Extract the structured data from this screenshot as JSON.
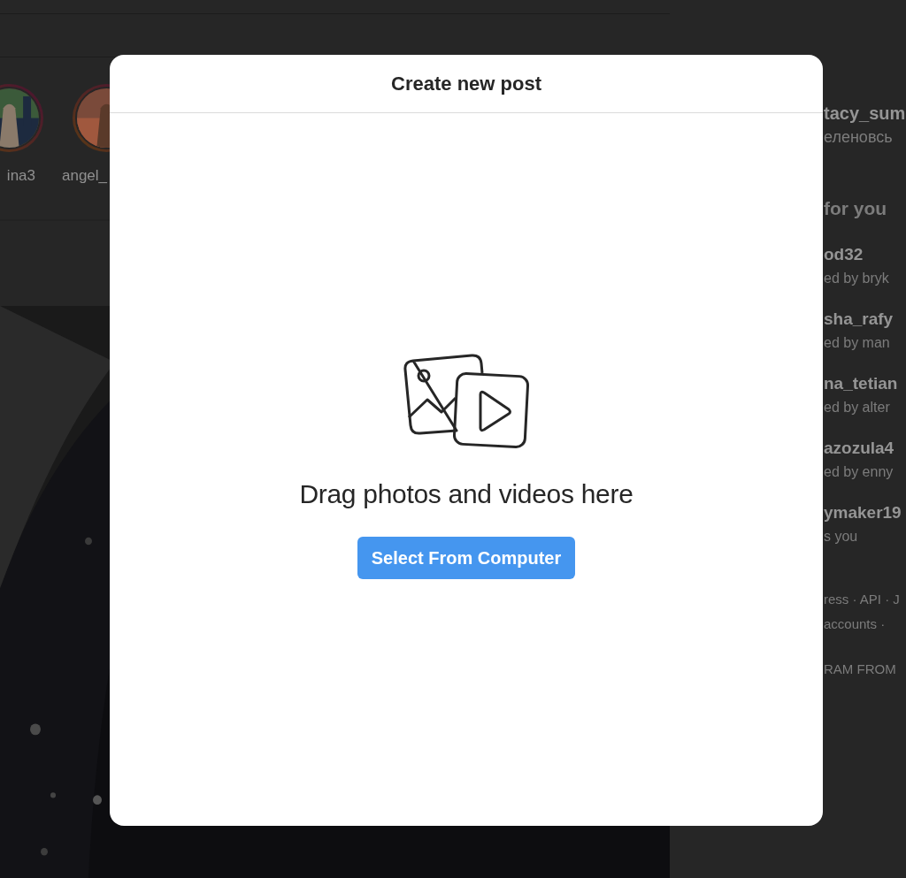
{
  "stories": [
    {
      "name": "ina3"
    },
    {
      "name": "angel_"
    }
  ],
  "sidebar": {
    "account": {
      "username": "tacy_sum",
      "full_name": "еленовсь"
    },
    "suggestions_title": "for you",
    "suggestions": [
      {
        "username": "od32",
        "note": "ed by bryk"
      },
      {
        "username": "sha_rafy",
        "note": "ed by man"
      },
      {
        "username": "na_tetian",
        "note": "ed by alter"
      },
      {
        "username": "azozula4",
        "note": "ed by enny"
      },
      {
        "username": "ymaker19",
        "note": "s you"
      }
    ],
    "footer_links": [
      "ress · API · J",
      "accounts · "
    ],
    "copyright": "RAM FROM"
  },
  "modal": {
    "title": "Create new post",
    "prompt": "Drag photos and videos here",
    "button": "Select From Computer"
  }
}
